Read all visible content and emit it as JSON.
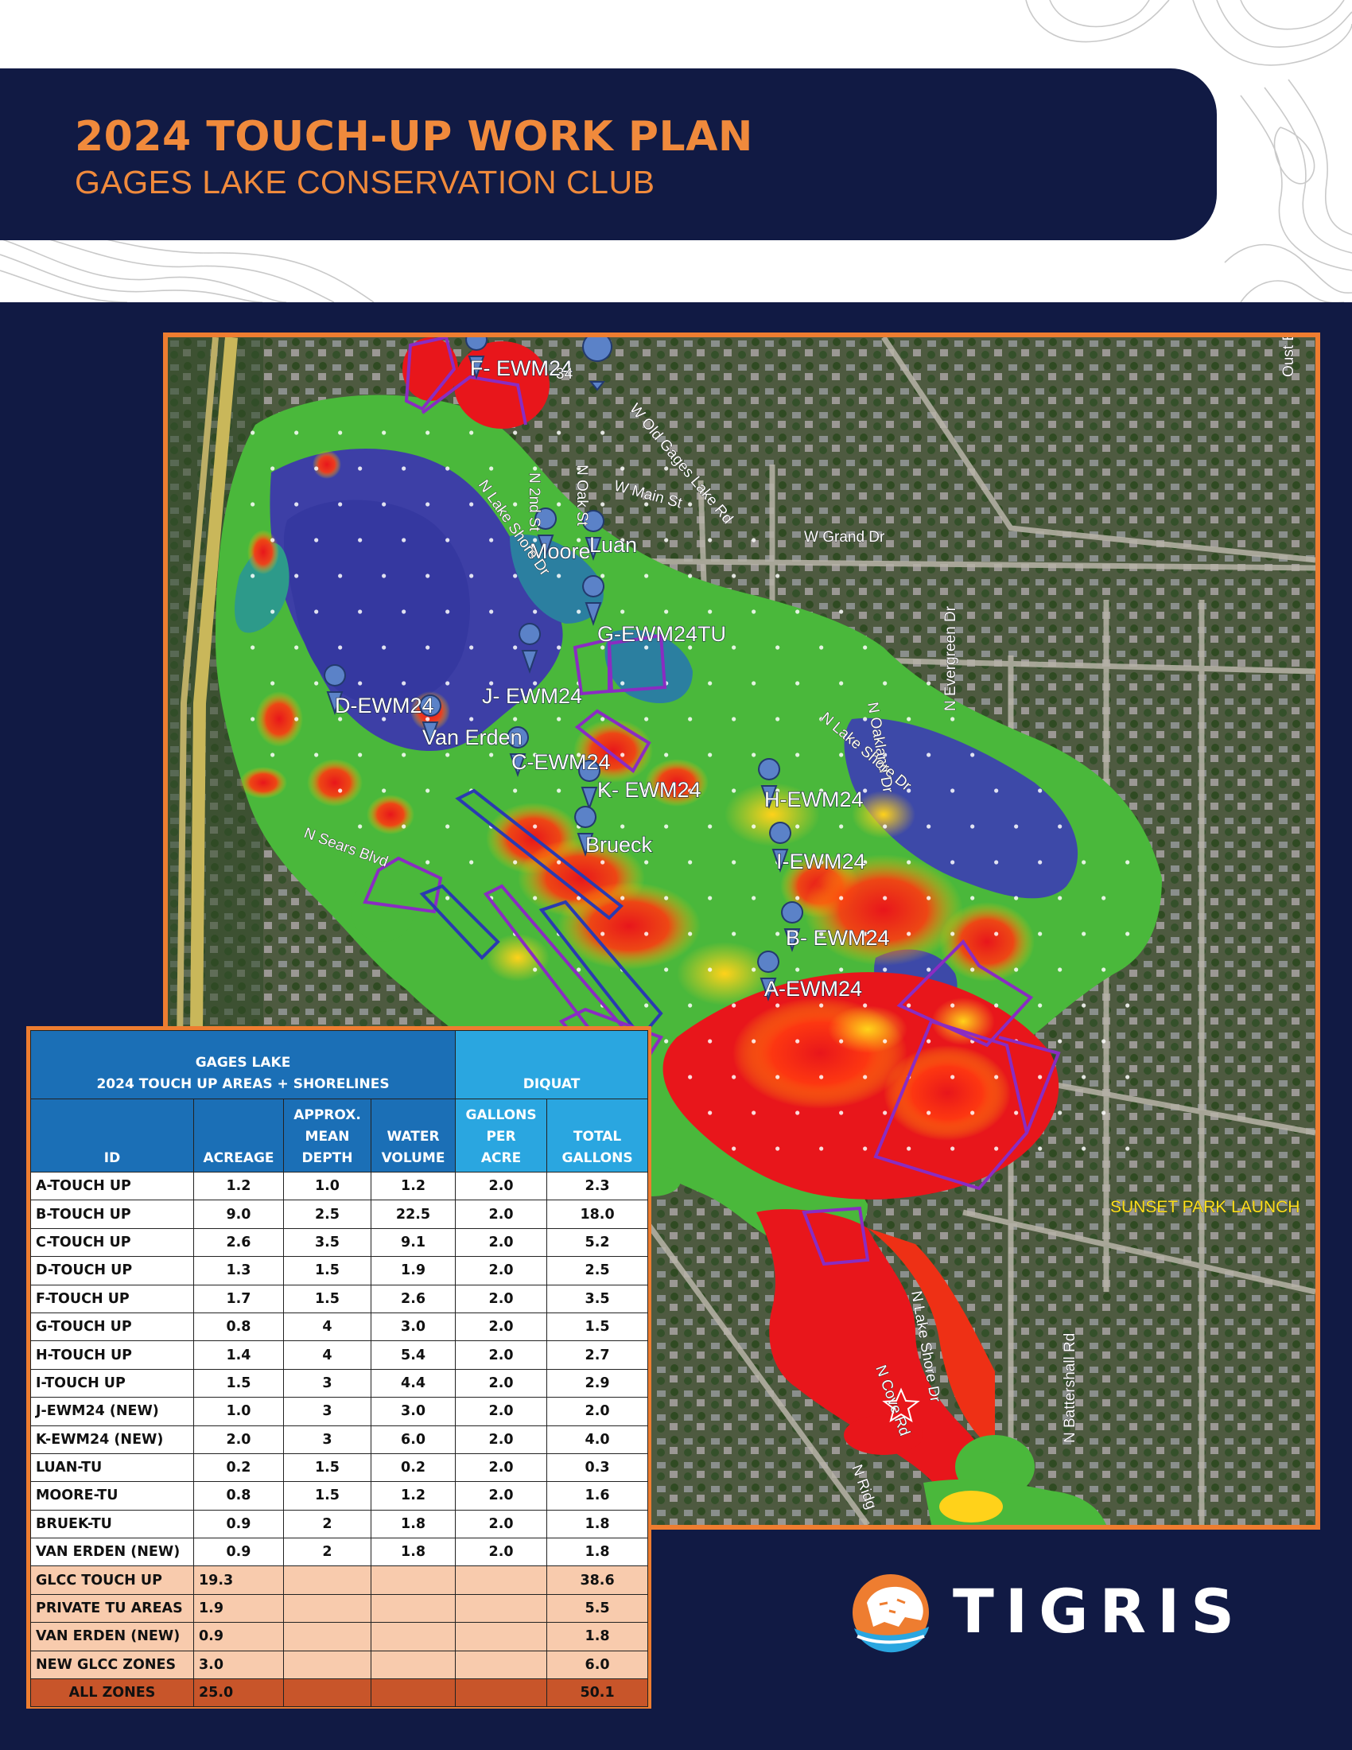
{
  "header": {
    "title": "2024 TOUCH-UP WORK PLAN",
    "subtitle": "GAGES LAKE CONSERVATION CLUB"
  },
  "map": {
    "zone_labels": [
      "F- EWM24",
      "Moore",
      "Luan",
      "G-EWM24TU",
      "J- EWM24",
      "D-EWM24",
      "Van Erden",
      "C-EWM24",
      "K- EWM24",
      "H-EWM24",
      "Brueck",
      "I-EWM24",
      "B- EWM24",
      "A-EWM24"
    ],
    "street_labels": [
      "34",
      "W Old Gages Lake Rd",
      "N 2nd St",
      "N Oak St",
      "N Lake Shore Dr",
      "W Main St",
      "W Grand Dr",
      "N Oakland Dr",
      "N Evergreen Dr",
      "N Lake Shore Dr",
      "N Sears Blvd",
      "N Cove Rd",
      "N Lake Shore Dr",
      "N Battershall Rd",
      "Oust Blvd F",
      "N Ridg"
    ],
    "launch_label": "SUNSET PARK LAUNCH"
  },
  "table": {
    "title_line1": "GAGES LAKE",
    "title_line2": "2024 TOUCH UP AREAS + SHORELINES",
    "diquat_header": "DIQUAT",
    "columns": {
      "id": "ID",
      "acreage": "ACREAGE",
      "depth": [
        "APPROX.",
        "MEAN",
        "DEPTH"
      ],
      "volume": [
        "WATER",
        "VOLUME"
      ],
      "gallons_per_acre": [
        "GALLONS",
        "PER",
        "ACRE"
      ],
      "total_gallons": [
        "TOTAL",
        "GALLONS"
      ]
    },
    "rows": [
      [
        "A-TOUCH UP",
        "1.2",
        "1.0",
        "1.2",
        "2.0",
        "2.3"
      ],
      [
        "B-TOUCH UP",
        "9.0",
        "2.5",
        "22.5",
        "2.0",
        "18.0"
      ],
      [
        "C-TOUCH UP",
        "2.6",
        "3.5",
        "9.1",
        "2.0",
        "5.2"
      ],
      [
        "D-TOUCH UP",
        "1.3",
        "1.5",
        "1.9",
        "2.0",
        "2.5"
      ],
      [
        "F-TOUCH UP",
        "1.7",
        "1.5",
        "2.6",
        "2.0",
        "3.5"
      ],
      [
        "G-TOUCH UP",
        "0.8",
        "4",
        "3.0",
        "2.0",
        "1.5"
      ],
      [
        "H-TOUCH UP",
        "1.4",
        "4",
        "5.4",
        "2.0",
        "2.7"
      ],
      [
        "I-TOUCH UP",
        "1.5",
        "3",
        "4.4",
        "2.0",
        "2.9"
      ],
      [
        "J-EWM24 (NEW)",
        "1.0",
        "3",
        "3.0",
        "2.0",
        "2.0"
      ],
      [
        "K-EWM24 (NEW)",
        "2.0",
        "3",
        "6.0",
        "2.0",
        "4.0"
      ],
      [
        "LUAN-TU",
        "0.2",
        "1.5",
        "0.2",
        "2.0",
        "0.3"
      ],
      [
        "MOORE-TU",
        "0.8",
        "1.5",
        "1.2",
        "2.0",
        "1.6"
      ],
      [
        "BRUEK-TU",
        "0.9",
        "2",
        "1.8",
        "2.0",
        "1.8"
      ],
      [
        "VAN ERDEN (NEW)",
        "0.9",
        "2",
        "1.8",
        "2.0",
        "1.8"
      ]
    ],
    "summary": [
      [
        "GLCC TOUCH UP",
        "19.3",
        "38.6"
      ],
      [
        "PRIVATE TU AREAS",
        "1.9",
        "5.5"
      ],
      [
        "VAN ERDEN (NEW)",
        "0.9",
        "1.8"
      ],
      [
        "NEW GLCC ZONES",
        "3.0",
        "6.0"
      ]
    ],
    "total": [
      "ALL ZONES",
      "25.0",
      "50.1"
    ]
  },
  "logo": {
    "text": "TIGRIS"
  },
  "colors": {
    "navy": "#111a44",
    "orange": "#ee7d30",
    "table_blue": "#1b6fb6",
    "table_light_blue": "#2aa6e0",
    "summary_peach": "#f8cbad",
    "total_rust": "#c8552a"
  }
}
